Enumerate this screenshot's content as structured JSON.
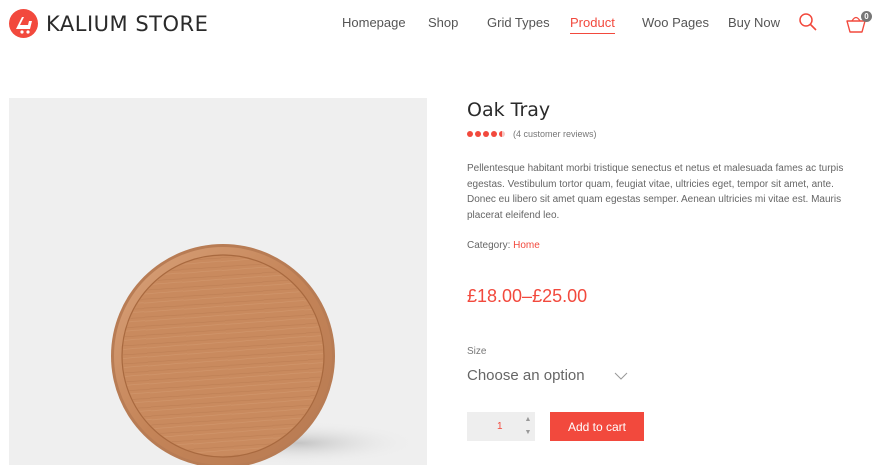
{
  "header": {
    "brand": "KALIUM STORE",
    "nav": [
      {
        "label": "Homepage",
        "active": false
      },
      {
        "label": "Shop",
        "active": false
      },
      {
        "label": "Grid Types",
        "active": false
      },
      {
        "label": "Product",
        "active": true
      },
      {
        "label": "Woo Pages",
        "active": false
      },
      {
        "label": "Buy Now",
        "active": false
      }
    ],
    "cart_count": "0",
    "icons": {
      "logo": "kalium-logo-icon",
      "search": "search-icon",
      "cart": "cart-icon"
    }
  },
  "product": {
    "title": "Oak Tray",
    "rating": 4.5,
    "rating_max": 5,
    "reviews_text": "(4 customer reviews)",
    "description": "Pellentesque habitant morbi tristique senectus et netus et malesuada fames ac turpis egestas. Vestibulum tortor quam, feugiat vitae, ultricies eget, tempor sit amet, ante. Donec eu libero sit amet quam egestas semper. Aenean ultricies mi vitae est. Mauris placerat eleifend leo.",
    "category_label": "Category:",
    "category_value": "Home",
    "price": "£18.00–£25.00",
    "size_label": "Size",
    "size_value": "Choose an option",
    "quantity": "1",
    "add_to_cart": "Add to cart"
  },
  "colors": {
    "accent": "#f2493d",
    "image_bg": "#efefef",
    "qty_bg": "#eeeeee"
  }
}
